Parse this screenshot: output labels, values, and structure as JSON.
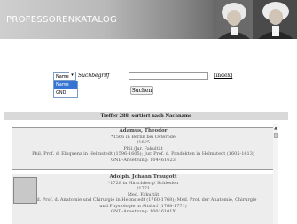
{
  "header": {
    "title": "PROFESSORENKATALOG"
  },
  "search": {
    "field_selected": "Name",
    "label": "Suchbegriff",
    "input_value": "",
    "index_link": "[index]",
    "submit_label": "Suchen",
    "dropdown_options": [
      "Name",
      "GND"
    ],
    "dropdown_arrow": "▾"
  },
  "results": {
    "summary": "Treffer 288, sortiert nach Nachname",
    "entries": [
      {
        "name": "Adamus, Theodor",
        "lines": [
          "*1566 in Berlin bei Osterode",
          "†1625",
          "Phil./Jur. Fakultät",
          "Phil. Prof. d. Eloquenz in Helmstedt (1596-1605); Jur. Prof. d. Pandekten in Helmstedt (1605-1613)",
          "GND-Ansetzung: 104461623"
        ]
      },
      {
        "name": "Adolph, Johann Traugott",
        "lines": [
          "*1728 in Hirschberg/ Schlesien",
          "†1771",
          "Med. Fakultät",
          "Med. Prof. d. Anatomie und Chirurgie in Helmstedt (1760-1768); Med. Prof. der Anatomie, Chirurgie",
          "und Physiologie in Altdorf (1768-1771)",
          "GND-Ansetzung: 10016101X"
        ]
      }
    ]
  },
  "scrollbar": {
    "up_arrow": "▲"
  }
}
